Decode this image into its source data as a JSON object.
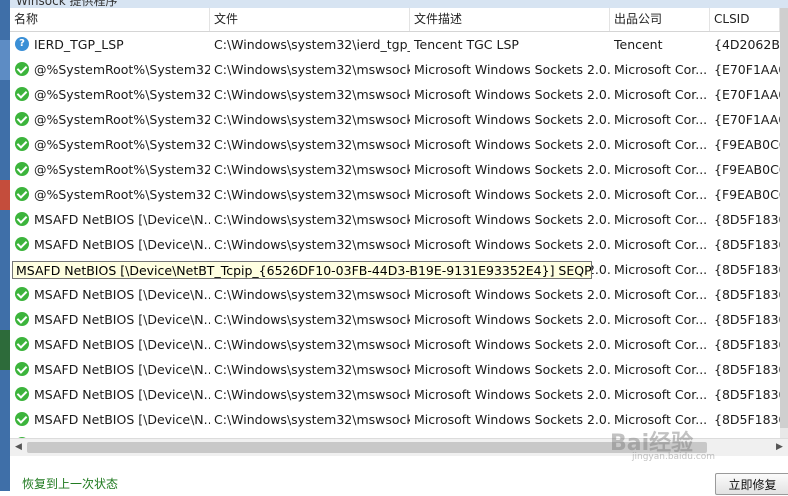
{
  "window": {
    "title": "Winsock 提供程序"
  },
  "columns": [
    "名称",
    "文件",
    "文件描述",
    "出品公司",
    "CLSID"
  ],
  "rows": [
    {
      "icon": "question-icon",
      "name": "IERD_TGP_LSP",
      "file": "C:\\Windows\\system32\\ierd_tgp_...",
      "desc": "Tencent TGC LSP",
      "company": "Tencent",
      "clsid": "{4D2062B0-"
    },
    {
      "icon": "check-icon",
      "name": "@%SystemRoot%\\System32...",
      "file": "C:\\Windows\\system32\\mswsock...",
      "desc": "Microsoft Windows Sockets 2.0...",
      "company": "Microsoft Cor...",
      "clsid": "{E70F1AA0-"
    },
    {
      "icon": "check-icon",
      "name": "@%SystemRoot%\\System32...",
      "file": "C:\\Windows\\system32\\mswsock...",
      "desc": "Microsoft Windows Sockets 2.0...",
      "company": "Microsoft Cor...",
      "clsid": "{E70F1AA0-"
    },
    {
      "icon": "check-icon",
      "name": "@%SystemRoot%\\System32...",
      "file": "C:\\Windows\\system32\\mswsock...",
      "desc": "Microsoft Windows Sockets 2.0...",
      "company": "Microsoft Cor...",
      "clsid": "{E70F1AA0-"
    },
    {
      "icon": "check-icon",
      "name": "@%SystemRoot%\\System32...",
      "file": "C:\\Windows\\system32\\mswsock...",
      "desc": "Microsoft Windows Sockets 2.0...",
      "company": "Microsoft Cor...",
      "clsid": "{F9EAB0C0-"
    },
    {
      "icon": "check-icon",
      "name": "@%SystemRoot%\\System32...",
      "file": "C:\\Windows\\system32\\mswsock...",
      "desc": "Microsoft Windows Sockets 2.0...",
      "company": "Microsoft Cor...",
      "clsid": "{F9EAB0C0-"
    },
    {
      "icon": "check-icon",
      "name": "@%SystemRoot%\\System32...",
      "file": "C:\\Windows\\system32\\mswsock...",
      "desc": "Microsoft Windows Sockets 2.0...",
      "company": "Microsoft Cor...",
      "clsid": "{F9EAB0C0-"
    },
    {
      "icon": "check-icon",
      "name": "MSAFD NetBIOS [\\Device\\N...",
      "file": "C:\\Windows\\system32\\mswsock...",
      "desc": "Microsoft Windows Sockets 2.0...",
      "company": "Microsoft Cor...",
      "clsid": "{8D5F1830-"
    },
    {
      "icon": "check-icon",
      "name": "MSAFD NetBIOS [\\Device\\N...",
      "file": "C:\\Windows\\system32\\mswsock...",
      "desc": "Microsoft Windows Sockets 2.0...",
      "company": "Microsoft Cor...",
      "clsid": "{8D5F1830-"
    },
    {
      "icon": "check-icon",
      "name": "MSAFD NetBIOS [\\Device\\N...",
      "file": "C:\\Windows\\system32\\mswsock...",
      "desc": "Microsoft Windows Sockets 2.0...",
      "company": "Microsoft Cor...",
      "clsid": "{8D5F1830-"
    },
    {
      "icon": "check-icon",
      "name": "MSAFD NetBIOS [\\Device\\N...",
      "file": "C:\\Windows\\system32\\mswsock...",
      "desc": "Microsoft Windows Sockets 2.0...",
      "company": "Microsoft Cor...",
      "clsid": "{8D5F1830-"
    },
    {
      "icon": "check-icon",
      "name": "MSAFD NetBIOS [\\Device\\N...",
      "file": "C:\\Windows\\system32\\mswsock...",
      "desc": "Microsoft Windows Sockets 2.0...",
      "company": "Microsoft Cor...",
      "clsid": "{8D5F1830-"
    },
    {
      "icon": "check-icon",
      "name": "MSAFD NetBIOS [\\Device\\N...",
      "file": "C:\\Windows\\system32\\mswsock...",
      "desc": "Microsoft Windows Sockets 2.0...",
      "company": "Microsoft Cor...",
      "clsid": "{8D5F1830-"
    },
    {
      "icon": "check-icon",
      "name": "MSAFD NetBIOS [\\Device\\N...",
      "file": "C:\\Windows\\system32\\mswsock...",
      "desc": "Microsoft Windows Sockets 2.0...",
      "company": "Microsoft Cor...",
      "clsid": "{8D5F1830-"
    },
    {
      "icon": "check-icon",
      "name": "MSAFD NetBIOS [\\Device\\N...",
      "file": "C:\\Windows\\system32\\mswsock...",
      "desc": "Microsoft Windows Sockets 2.0...",
      "company": "Microsoft Cor...",
      "clsid": "{8D5F1830-"
    },
    {
      "icon": "check-icon",
      "name": "MSAFD NetBIOS [\\Device\\N...",
      "file": "C:\\Windows\\system32\\mswsock...",
      "desc": "Microsoft Windows Sockets 2.0...",
      "company": "Microsoft Cor...",
      "clsid": "{8D5F1830-"
    },
    {
      "icon": "check-icon",
      "name": "MSAFD NetBIOS [\\Device\\N...",
      "file": "C:\\Windows\\system32\\mswsock...",
      "desc": "Microsoft Windows Sockets 2.0...",
      "company": "Microsoft Cor...",
      "clsid": "{8D5F1830-"
    }
  ],
  "tooltip": "MSAFD NetBIOS [\\Device\\NetBT_Tcpip_{6526DF10-03FB-44D3-B19E-9131E93352E4}] SEQPACKET 7",
  "footer": {
    "restore_link": "恢复到上一次状态",
    "repair_button": "立即修复"
  },
  "watermark": {
    "brand": "Bai经验",
    "url": "jingyan.baidu.com"
  },
  "colors": {
    "check": "#3cb43c",
    "question": "#3a8fd6",
    "link": "#1f7a1f",
    "tooltip_bg": "#ffffe1"
  }
}
